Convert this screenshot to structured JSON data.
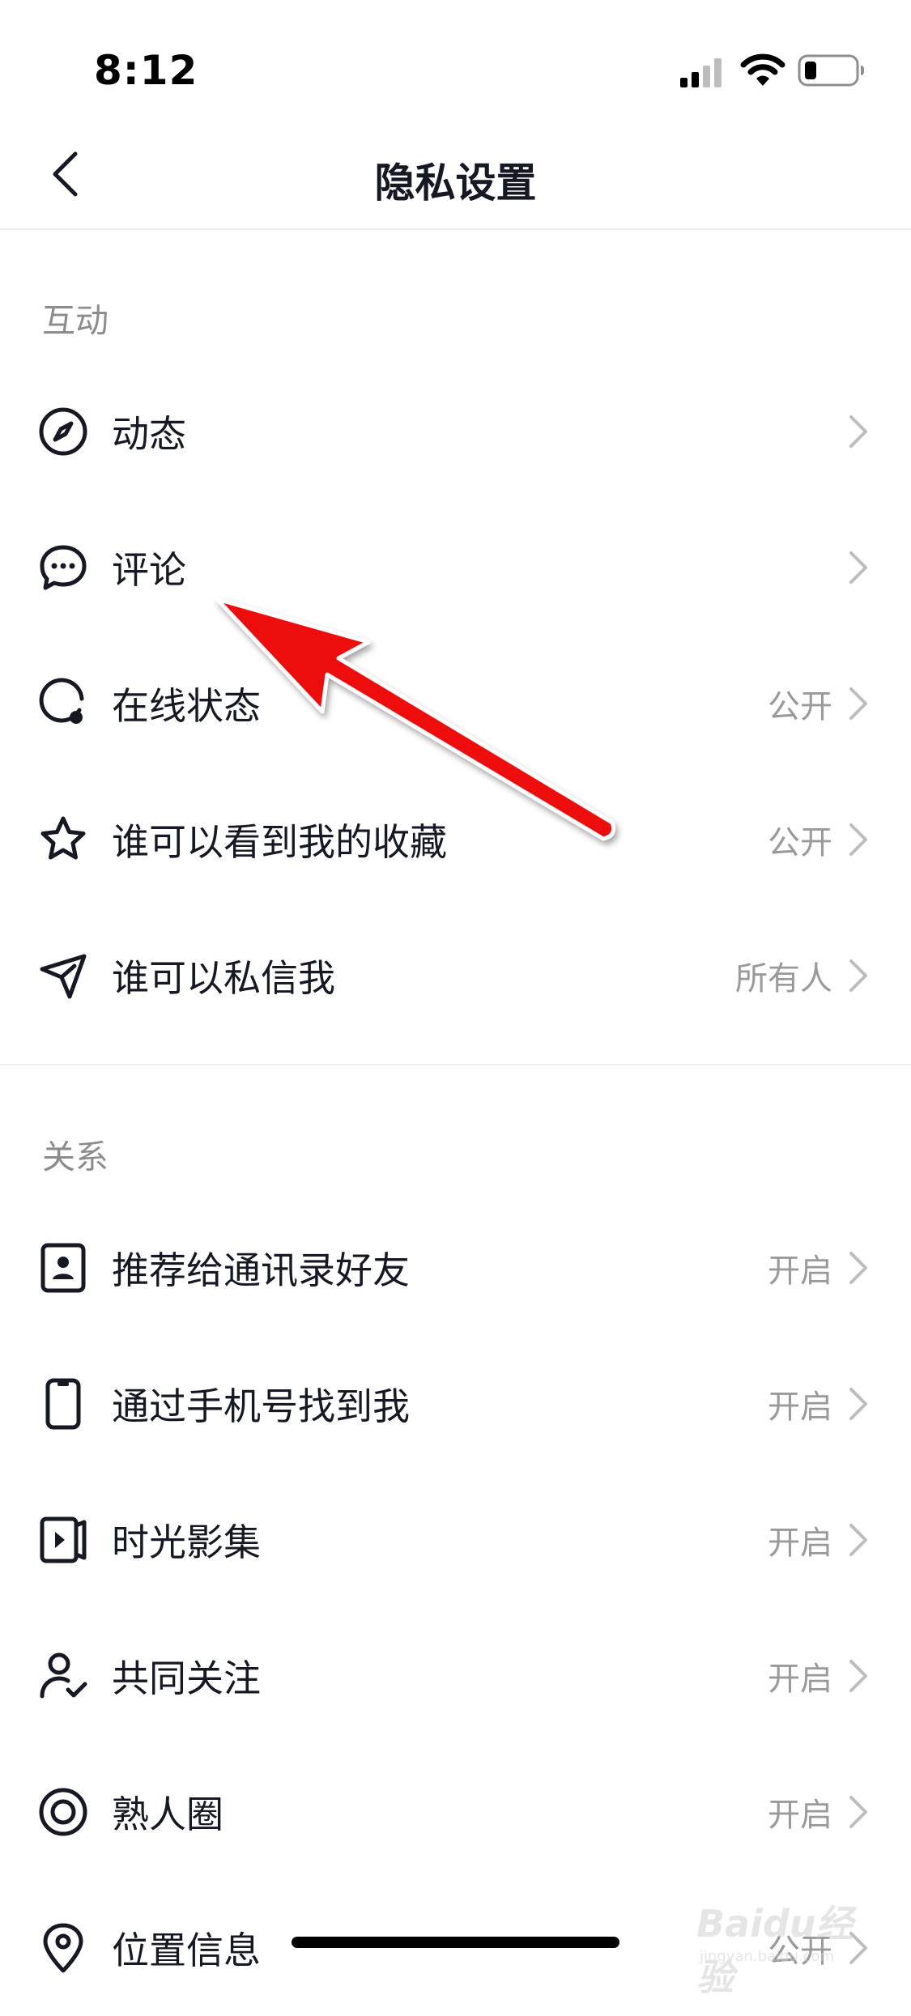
{
  "status": {
    "time": "8:12"
  },
  "header": {
    "title": "隐私设置"
  },
  "sections": [
    {
      "title": "互动",
      "items": [
        {
          "label": "动态",
          "value": "",
          "icon": "compass-icon"
        },
        {
          "label": "评论",
          "value": "",
          "icon": "comment-icon"
        },
        {
          "label": "在线状态",
          "value": "公开",
          "icon": "online-status-icon"
        },
        {
          "label": "谁可以看到我的收藏",
          "value": "公开",
          "icon": "star-icon"
        },
        {
          "label": "谁可以私信我",
          "value": "所有人",
          "icon": "send-icon"
        }
      ]
    },
    {
      "title": "关系",
      "items": [
        {
          "label": "推荐给通讯录好友",
          "value": "开启",
          "icon": "contact-card-icon"
        },
        {
          "label": "通过手机号找到我",
          "value": "开启",
          "icon": "phone-icon"
        },
        {
          "label": "时光影集",
          "value": "开启",
          "icon": "album-icon"
        },
        {
          "label": "共同关注",
          "value": "开启",
          "icon": "user-check-icon"
        },
        {
          "label": "熟人圈",
          "value": "开启",
          "icon": "circle-icon"
        },
        {
          "label": "位置信息",
          "value": "公开",
          "icon": "location-pin-icon"
        }
      ]
    }
  ],
  "watermark": {
    "text": "Baidu经验",
    "sub": "jingyan.baidu.com"
  },
  "colors": {
    "text": "#161823",
    "secondary": "#9a9a9a",
    "section": "#8c8c8c",
    "arrow": "#ee1010"
  }
}
